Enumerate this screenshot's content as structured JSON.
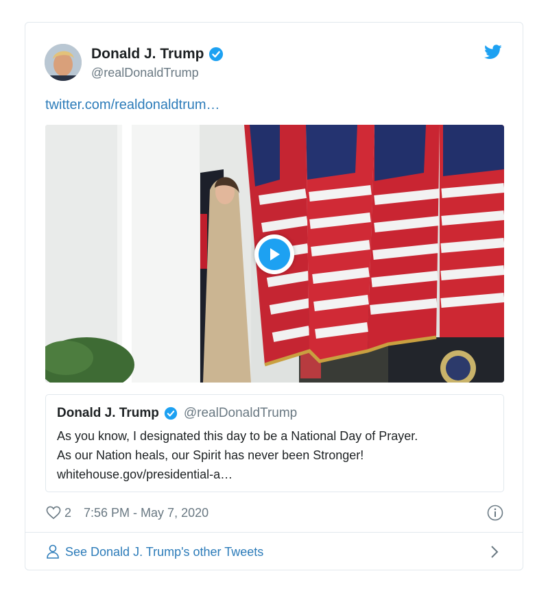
{
  "tweet": {
    "author_name": "Donald J. Trump",
    "author_handle": "@realDonaldTrump",
    "link_text": "twitter.com/realdonaldtrum…",
    "icons": {
      "avatar": "avatar-photo",
      "verified": "verified-badge-icon",
      "logo": "twitter-bird-icon",
      "play": "play-icon"
    }
  },
  "quote": {
    "author_name": "Donald J. Trump",
    "author_handle": "@realDonaldTrump",
    "lines": [
      "As you know, I designated this day to be a National Day of Prayer.",
      "As our Nation heals, our Spirit has never been Stronger!",
      "whitehouse.gov/presidential-a…"
    ]
  },
  "meta": {
    "like_count": "2",
    "timestamp": "7:56 PM - May 7, 2020"
  },
  "footer": {
    "label": "See Donald J. Trump's other Tweets"
  },
  "colors": {
    "link": "#2b7bb9",
    "twitter_blue": "#1da1f2",
    "text_secondary": "#697882",
    "border": "#e1e8ed"
  }
}
